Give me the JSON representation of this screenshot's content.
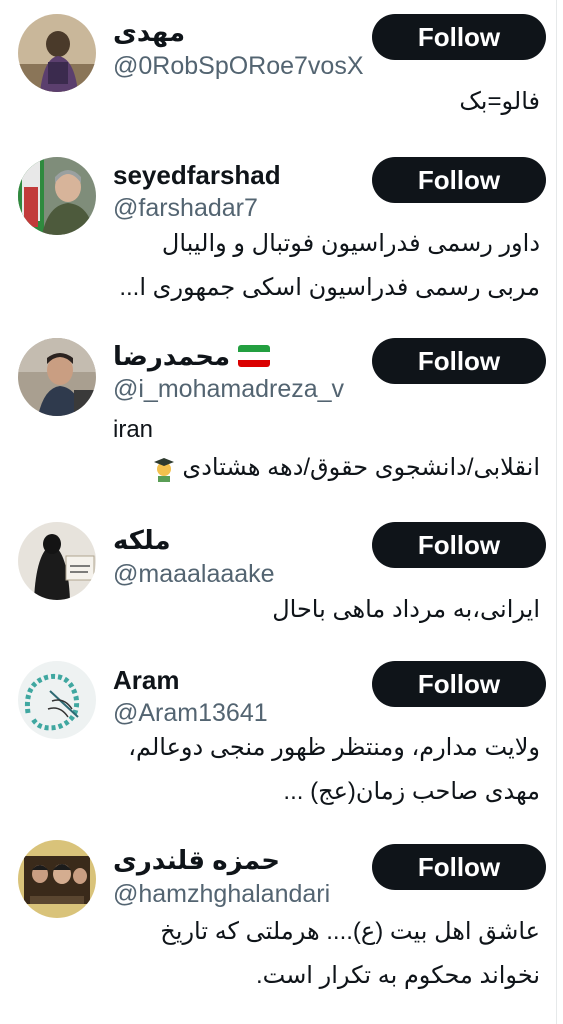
{
  "follow_label": "Follow",
  "users": [
    {
      "name": "مهدی",
      "handle": "@0RobSpORoe7vosX",
      "bio": [
        "فالو=بک"
      ]
    },
    {
      "name": "seyedfarshad",
      "handle": "@farshadar7",
      "bio": [
        "داور رسمی فدراسیون فوتبال و والیبال",
        "مربی رسمی فدراسیون اسکی جمهوری ا..."
      ]
    },
    {
      "name": "محمدرضا",
      "handle": "@i_mohamadreza_v",
      "bio": [
        "iran",
        "انقلابی/دانشجوی حقوق/دهه هشتادی"
      ]
    },
    {
      "name": "ملکه",
      "handle": "@maaalaaake",
      "bio": [
        "ایرانی،به مرداد ماهی باحال"
      ]
    },
    {
      "name": "Aram",
      "handle": "@Aram13641",
      "bio": [
        "ولایت مدارم، ومنتظر ظهور منجی دوعالم،",
        "مهدی صاحب زمان(عج) ..."
      ]
    },
    {
      "name": "حمزه قلندری",
      "handle": "@hamzhghalandari",
      "bio": [
        "عاشق اهل بیت (ع).... هرملتی که تاریخ",
        "نخواند محکوم به تکرار است."
      ]
    }
  ]
}
